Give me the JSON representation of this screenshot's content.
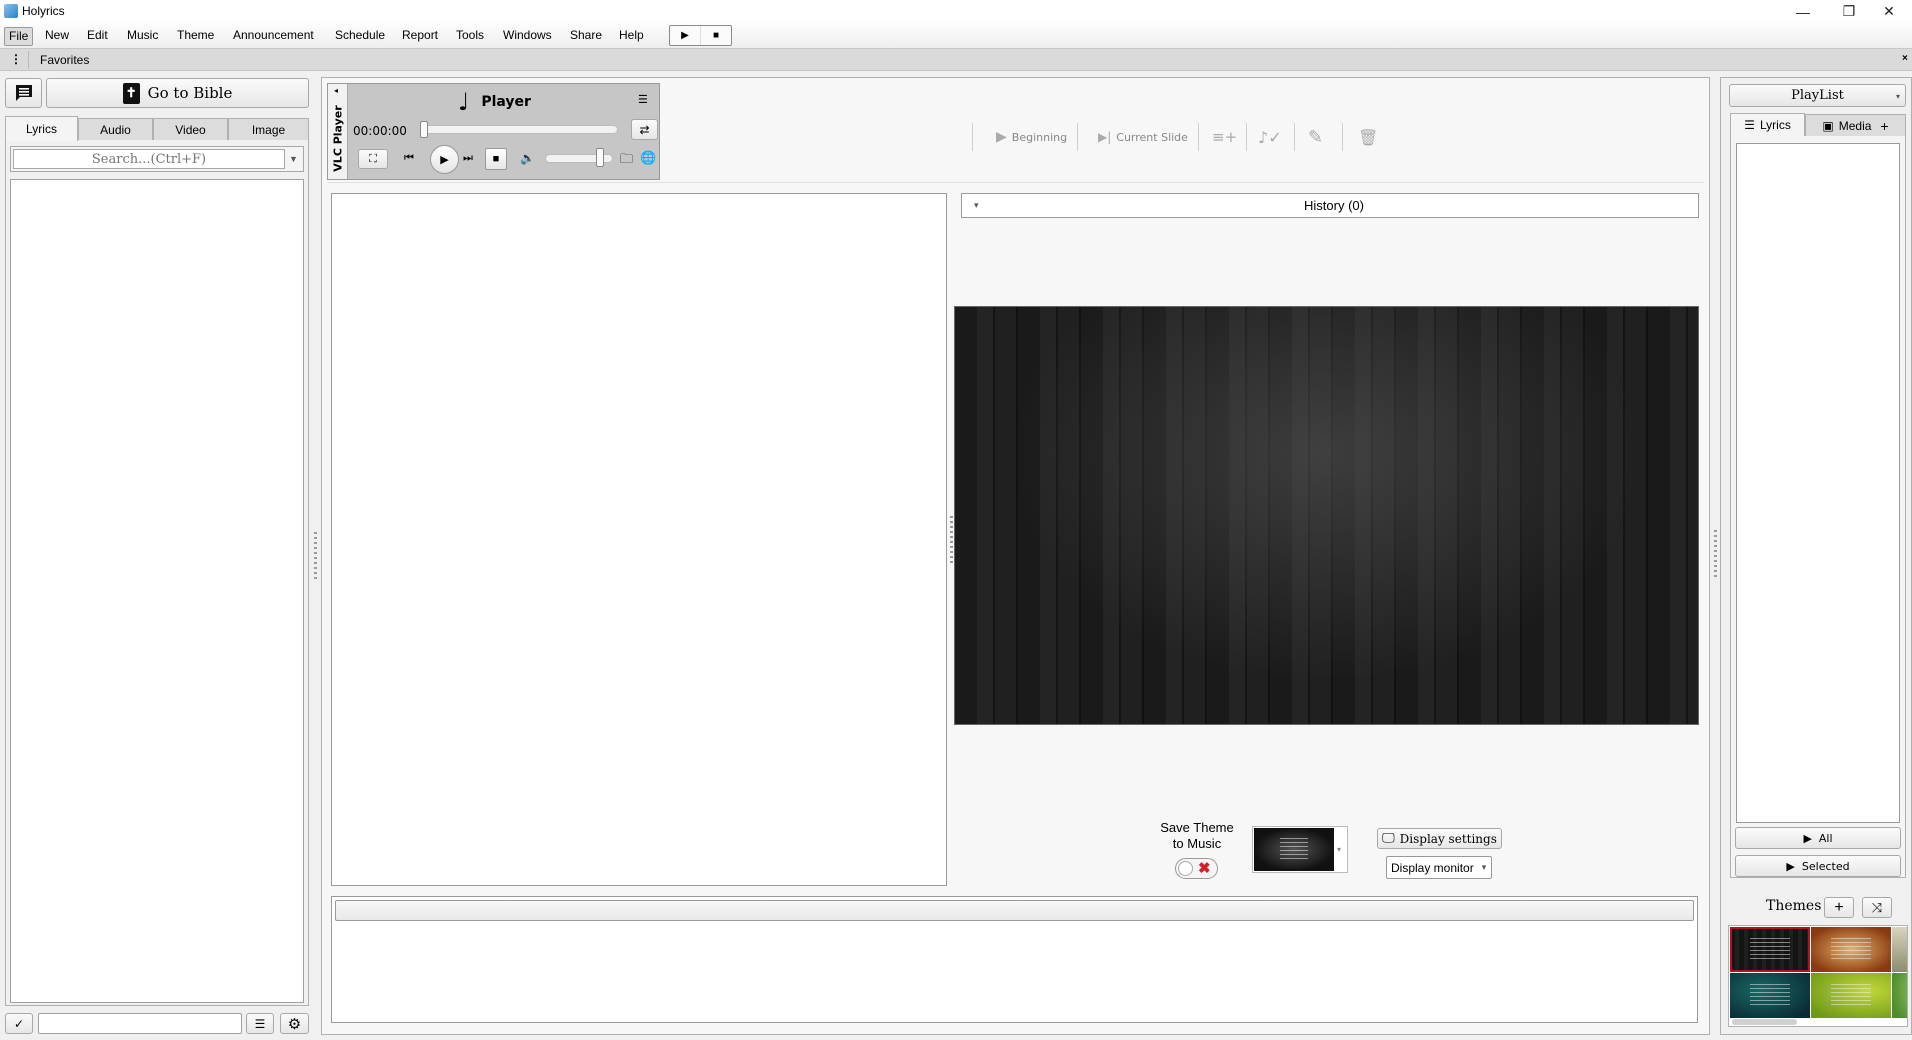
{
  "window": {
    "title": "Holyrics",
    "controls": {
      "minimize": "—",
      "maximize": "❐",
      "close": "✕"
    }
  },
  "menu": {
    "items": [
      "File",
      "New",
      "Edit",
      "Music",
      "Theme",
      "Announcement",
      "Schedule",
      "Report",
      "Tools",
      "Windows",
      "Share",
      "Help"
    ],
    "active": "File",
    "quick_play": "▶",
    "quick_stop": "■"
  },
  "favorites": {
    "handle": "⋮",
    "label": "Favorites",
    "close": "×"
  },
  "left_panel": {
    "chat_icon": "chat-bubble-icon",
    "bible_button": "Go to Bible",
    "bible_icon_glyph": "✝",
    "tabs": [
      "Lyrics",
      "Audio",
      "Video",
      "Image"
    ],
    "active_tab": "Lyrics",
    "search_placeholder": "Search...(Ctrl+F)",
    "search_value": "",
    "footer": {
      "check": "✓",
      "input_value": "",
      "list": "☰",
      "gear": "⚙"
    }
  },
  "vlc_player": {
    "side_label": "VLC Player",
    "collapse_arrow": "◂",
    "title": "Player",
    "note_glyph": "♩",
    "menu_glyph": "☰",
    "time": "00:00:00",
    "progress_fraction": 0.0,
    "volume_fraction": 0.85,
    "repeat_glyph": "⇄",
    "screen_glyph": "⛶",
    "prev_glyph": "⏮",
    "play_glyph": "▶",
    "next_glyph": "⏭",
    "stop_glyph": "■",
    "volume_glyph": "🔈",
    "folder_glyph": "🗀",
    "globe_glyph": "🌐"
  },
  "center_toolbar": {
    "beginning": "Beginning",
    "beginning_glyph": "▶",
    "current_slide": "Current Slide",
    "current_slide_glyph": "▶|",
    "add_to_list_glyph": "≡+",
    "music_check_glyph": "♪✓",
    "edit_glyph": "✎",
    "delete_glyph": "🗑"
  },
  "history": {
    "label": "History (0)",
    "arrow": "▾"
  },
  "theme_controls": {
    "save_theme_label_line1": "Save Theme",
    "save_theme_label_line2": "to Music",
    "save_theme_enabled": false,
    "toggle_off_glyph": "✖",
    "theme_dropdown_arrow": "▾",
    "display_settings": "Display settings",
    "display_settings_glyph": "🖵",
    "display_monitor": "Display monitor",
    "display_monitor_arrow": "▾"
  },
  "right_panel": {
    "playlist_label": "PlayList",
    "playlist_arrow": "▾",
    "tabs": [
      {
        "label": "Lyrics",
        "glyph": "☰"
      },
      {
        "label": "Media",
        "glyph": "▣",
        "extra": "+"
      }
    ],
    "active_tab": "Lyrics",
    "all_button": "All",
    "selected_button": "Selected",
    "play_glyph": "▶",
    "themes_label": "Themes",
    "themes_add": "+",
    "themes_shuffle": "⤨",
    "themes": [
      {
        "name": "dark-wood",
        "color": "#1a1a1a",
        "selected": true
      },
      {
        "name": "parchment",
        "color": "#b5621e",
        "selected": false
      },
      {
        "name": "light-nature",
        "color": "#b9b59a",
        "selected": false
      },
      {
        "name": "teal-gradient",
        "color": "#0f4d55",
        "selected": false
      },
      {
        "name": "green-leaf",
        "color": "#9cbb2a",
        "selected": false
      },
      {
        "name": "green-bokeh",
        "color": "#7db84a",
        "selected": false
      }
    ],
    "selected_border_color": "#b3121e"
  }
}
